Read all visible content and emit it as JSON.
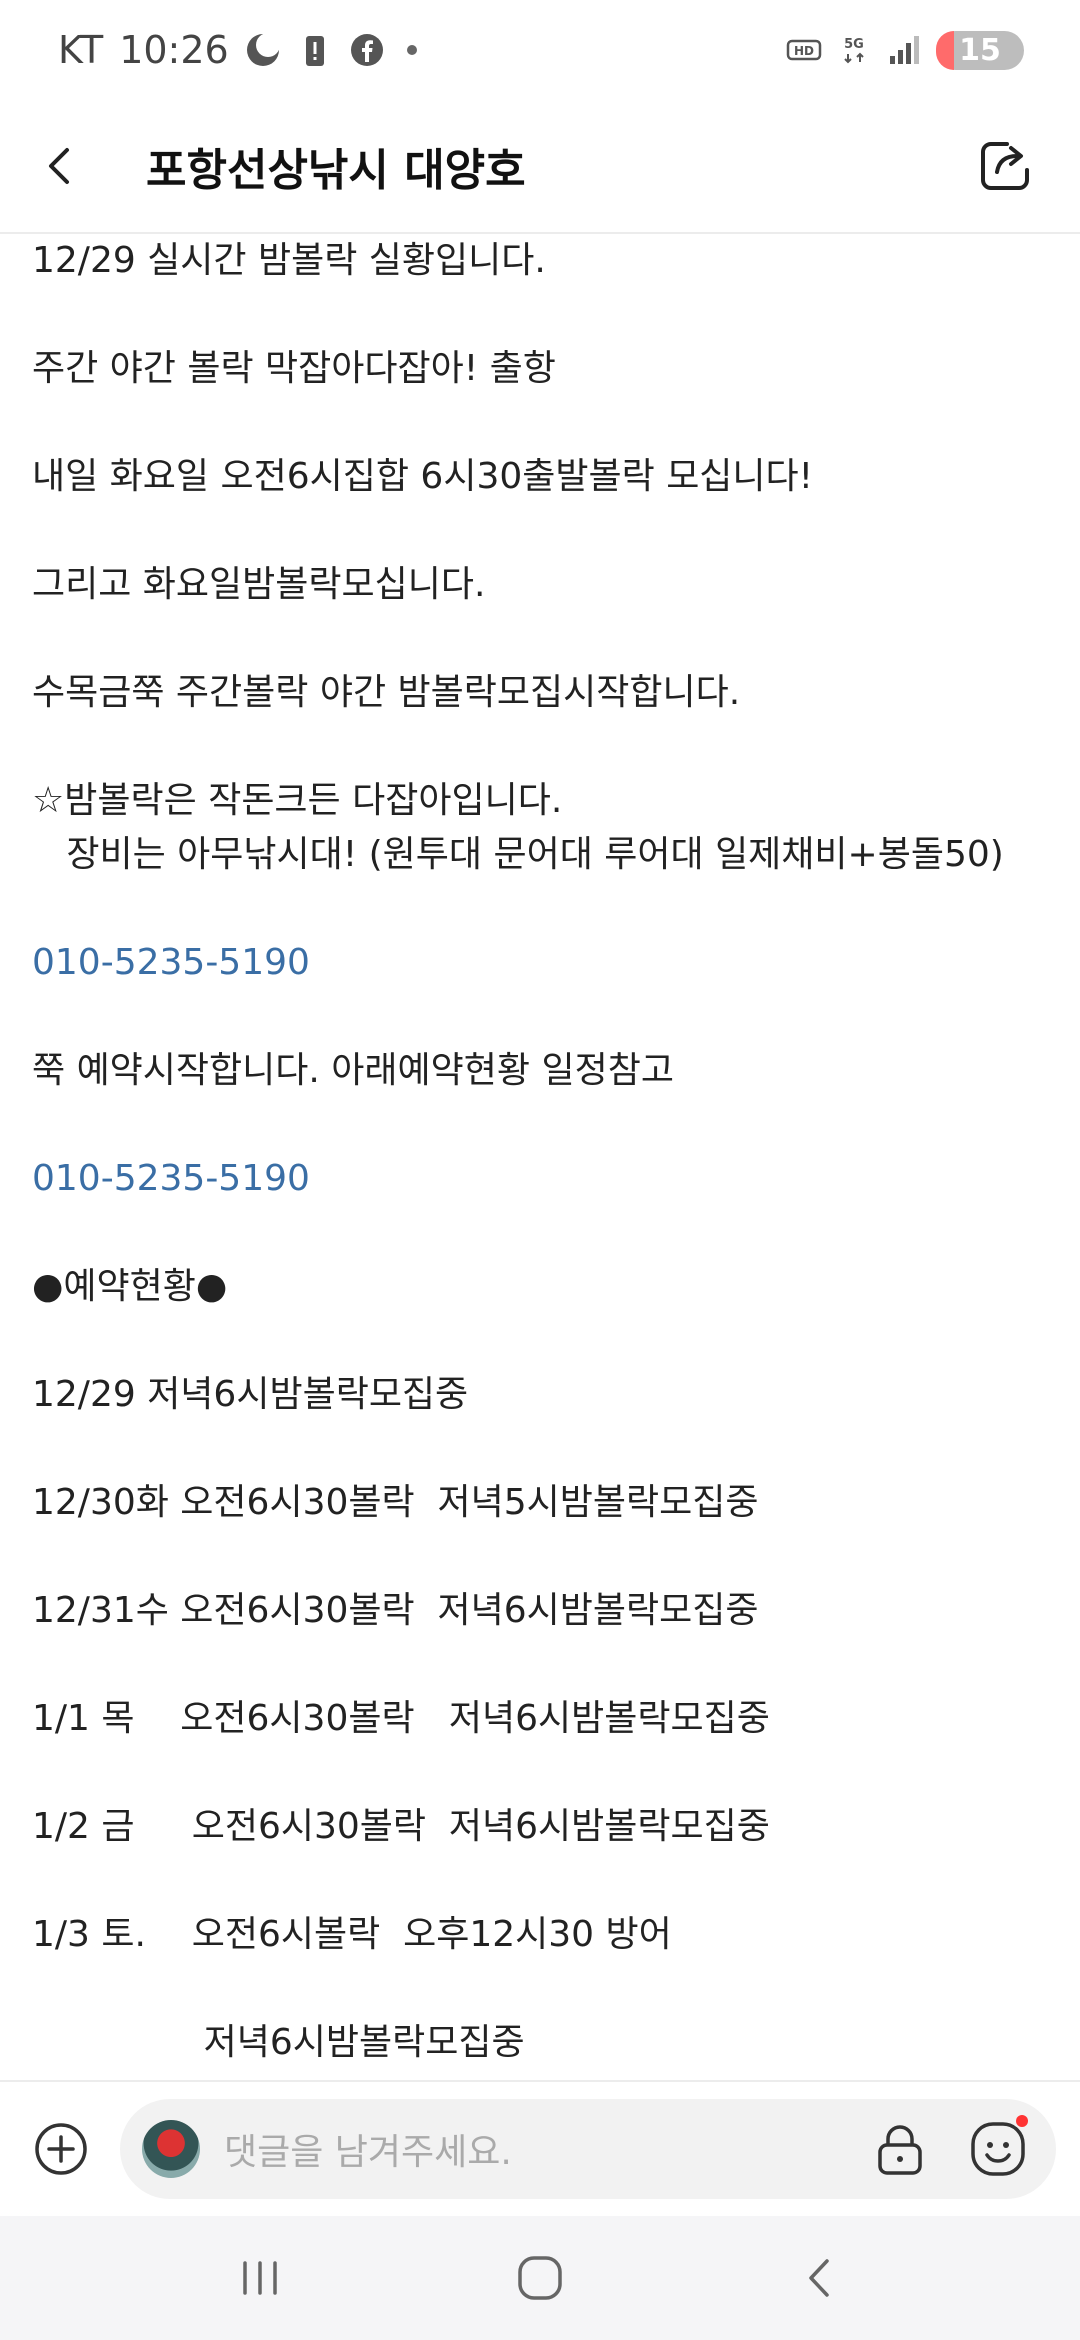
{
  "status_bar": {
    "carrier": "KT",
    "time": "10:26",
    "network": "5G",
    "hd": "HD",
    "battery": "15"
  },
  "header": {
    "title": "포항선상낚시 대양호"
  },
  "post": {
    "lines": [
      {
        "text": "12/29 실시간 밤볼락 실황입니다.",
        "type": "text"
      },
      {
        "text": "",
        "type": "blank"
      },
      {
        "text": "주간 야간 볼락 막잡아다잡아! 출항",
        "type": "text"
      },
      {
        "text": "",
        "type": "blank"
      },
      {
        "text": "내일 화요일 오전6시집합 6시30출발볼락 모십니다!",
        "type": "text"
      },
      {
        "text": "",
        "type": "blank"
      },
      {
        "text": "그리고 화요일밤볼락모십니다.",
        "type": "text"
      },
      {
        "text": "",
        "type": "blank"
      },
      {
        "text": "수목금쭉 주간볼락 야간 밤볼락모집시작합니다.",
        "type": "text"
      },
      {
        "text": "",
        "type": "blank"
      },
      {
        "text": "☆밤볼락은 작돈크든 다잡아입니다.",
        "type": "text"
      },
      {
        "text": "   장비는 아무낚시대! (원투대 문어대 루어대 일제채비+봉돌50)",
        "type": "text"
      },
      {
        "text": "",
        "type": "blank"
      },
      {
        "text": "010-5235-5190",
        "type": "phone"
      },
      {
        "text": "",
        "type": "blank"
      },
      {
        "text": "쭉 예약시작합니다. 아래예약현황 일정참고",
        "type": "text"
      },
      {
        "text": "",
        "type": "blank"
      },
      {
        "text": "010-5235-5190",
        "type": "phone"
      },
      {
        "text": "",
        "type": "blank"
      },
      {
        "text": "●예약현황●",
        "type": "text"
      },
      {
        "text": "",
        "type": "blank"
      },
      {
        "text": "12/29 저녁6시밤볼락모집중",
        "type": "text"
      },
      {
        "text": "",
        "type": "blank"
      },
      {
        "text": "12/30화 오전6시30볼락  저녁5시밤볼락모집중",
        "type": "text"
      },
      {
        "text": "",
        "type": "blank"
      },
      {
        "text": "12/31수 오전6시30볼락  저녁6시밤볼락모집중",
        "type": "text"
      },
      {
        "text": "",
        "type": "blank"
      },
      {
        "text": "1/1 목    오전6시30볼락   저녁6시밤볼락모집중",
        "type": "text"
      },
      {
        "text": "",
        "type": "blank"
      },
      {
        "text": "1/2 금     오전6시30볼락  저녁6시밤볼락모집중",
        "type": "text"
      },
      {
        "text": "",
        "type": "blank"
      },
      {
        "text": "1/3 토.    오전6시볼락  오후12시30 방어",
        "type": "text"
      },
      {
        "text": "",
        "type": "blank"
      },
      {
        "text": "               저녁6시밤볼락모집중",
        "type": "text"
      }
    ]
  },
  "comment_bar": {
    "placeholder": "댓글을 남겨주세요."
  },
  "icons": {
    "back": "back-arrow-icon",
    "share": "share-icon",
    "plus": "plus-circle-icon",
    "lock": "lock-icon",
    "emoji": "emoji-icon"
  }
}
